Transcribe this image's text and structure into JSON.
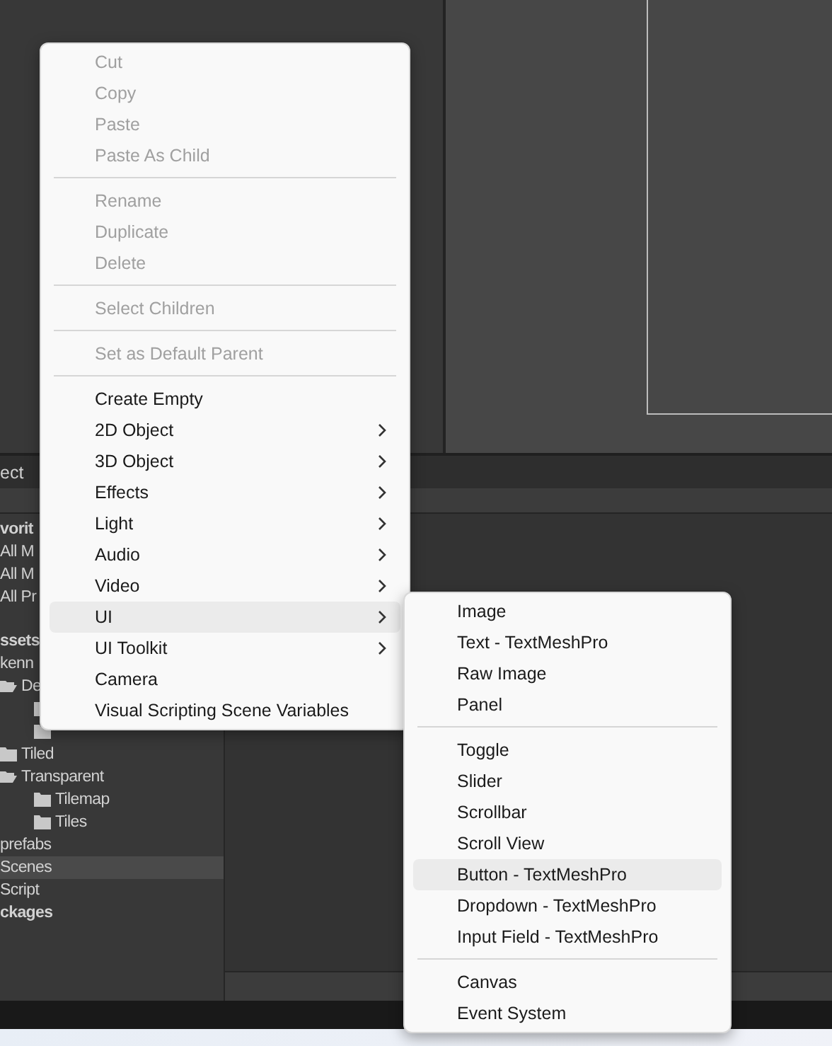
{
  "project_panel": {
    "tab": "ect",
    "tree": [
      {
        "kind": "header",
        "label": "vorit",
        "children": [
          {
            "kind": "item",
            "label": "All M"
          },
          {
            "kind": "item",
            "label": "All M"
          },
          {
            "kind": "item",
            "label": "All Pr"
          }
        ]
      },
      {
        "kind": "header",
        "label": "ssets",
        "children": [
          {
            "kind": "item",
            "label": "kenn",
            "children": [
              {
                "kind": "folder",
                "label": "De",
                "expanded": true,
                "children": [
                  {
                    "kind": "folder"
                  },
                  {
                    "kind": "folder"
                  }
                ]
              },
              {
                "kind": "folder",
                "label": "Tiled",
                "expanded": false
              },
              {
                "kind": "folder",
                "label": "Transparent",
                "expanded": true,
                "children": [
                  {
                    "kind": "folder",
                    "label": "Tilemap"
                  },
                  {
                    "kind": "folder",
                    "label": "Tiles"
                  }
                ]
              }
            ]
          },
          {
            "kind": "item",
            "label": "prefabs",
            "selected": false
          },
          {
            "kind": "item",
            "label": "Scenes",
            "selected": true
          },
          {
            "kind": "item",
            "label": "Script",
            "selected": false
          }
        ]
      },
      {
        "kind": "header",
        "label": "ckages"
      }
    ]
  },
  "context_menu": {
    "groups": [
      [
        {
          "kind": "action",
          "label": "Cut",
          "disabled": true
        },
        {
          "kind": "action",
          "label": "Copy",
          "disabled": true
        },
        {
          "kind": "action",
          "label": "Paste",
          "disabled": true
        },
        {
          "kind": "action",
          "label": "Paste As Child",
          "disabled": true
        }
      ],
      [
        {
          "kind": "action",
          "label": "Rename",
          "disabled": true
        },
        {
          "kind": "action",
          "label": "Duplicate",
          "disabled": true
        },
        {
          "kind": "action",
          "label": "Delete",
          "disabled": true
        }
      ],
      [
        {
          "kind": "action",
          "label": "Select Children",
          "disabled": true
        }
      ],
      [
        {
          "kind": "action",
          "label": "Set as Default Parent",
          "disabled": true
        }
      ],
      [
        {
          "kind": "action",
          "label": "Create Empty",
          "disabled": false,
          "selected": false
        },
        {
          "kind": "submenu",
          "label": "2D Object",
          "disabled": false,
          "selected": false
        },
        {
          "kind": "submenu",
          "label": "3D Object",
          "disabled": false,
          "selected": false
        },
        {
          "kind": "submenu",
          "label": "Effects",
          "disabled": false,
          "selected": false
        },
        {
          "kind": "submenu",
          "label": "Light",
          "disabled": false,
          "selected": false
        },
        {
          "kind": "submenu",
          "label": "Audio",
          "disabled": false,
          "selected": false
        },
        {
          "kind": "submenu",
          "label": "Video",
          "disabled": false,
          "selected": false
        },
        {
          "kind": "submenu",
          "label": "UI",
          "disabled": false,
          "selected": true
        },
        {
          "kind": "submenu",
          "label": "UI Toolkit",
          "disabled": false,
          "selected": false
        },
        {
          "kind": "action",
          "label": "Camera",
          "disabled": false,
          "selected": false
        },
        {
          "kind": "action",
          "label": "Visual Scripting Scene Variables",
          "disabled": false,
          "selected": false
        }
      ]
    ]
  },
  "submenu": {
    "groups": [
      [
        {
          "label": "Image",
          "selected": false
        },
        {
          "label": "Text - TextMeshPro",
          "selected": false
        },
        {
          "label": "Raw Image",
          "selected": false
        },
        {
          "label": "Panel",
          "selected": false
        }
      ],
      [
        {
          "label": "Toggle",
          "selected": false
        },
        {
          "label": "Slider",
          "selected": false
        },
        {
          "label": "Scrollbar",
          "selected": false
        },
        {
          "label": "Scroll View",
          "selected": false
        },
        {
          "label": "Button - TextMeshPro",
          "selected": true
        },
        {
          "label": "Dropdown - TextMeshPro",
          "selected": false
        },
        {
          "label": "Input Field - TextMeshPro",
          "selected": false
        }
      ],
      [
        {
          "label": "Canvas",
          "selected": false
        },
        {
          "label": "Event System",
          "selected": false
        }
      ]
    ]
  }
}
